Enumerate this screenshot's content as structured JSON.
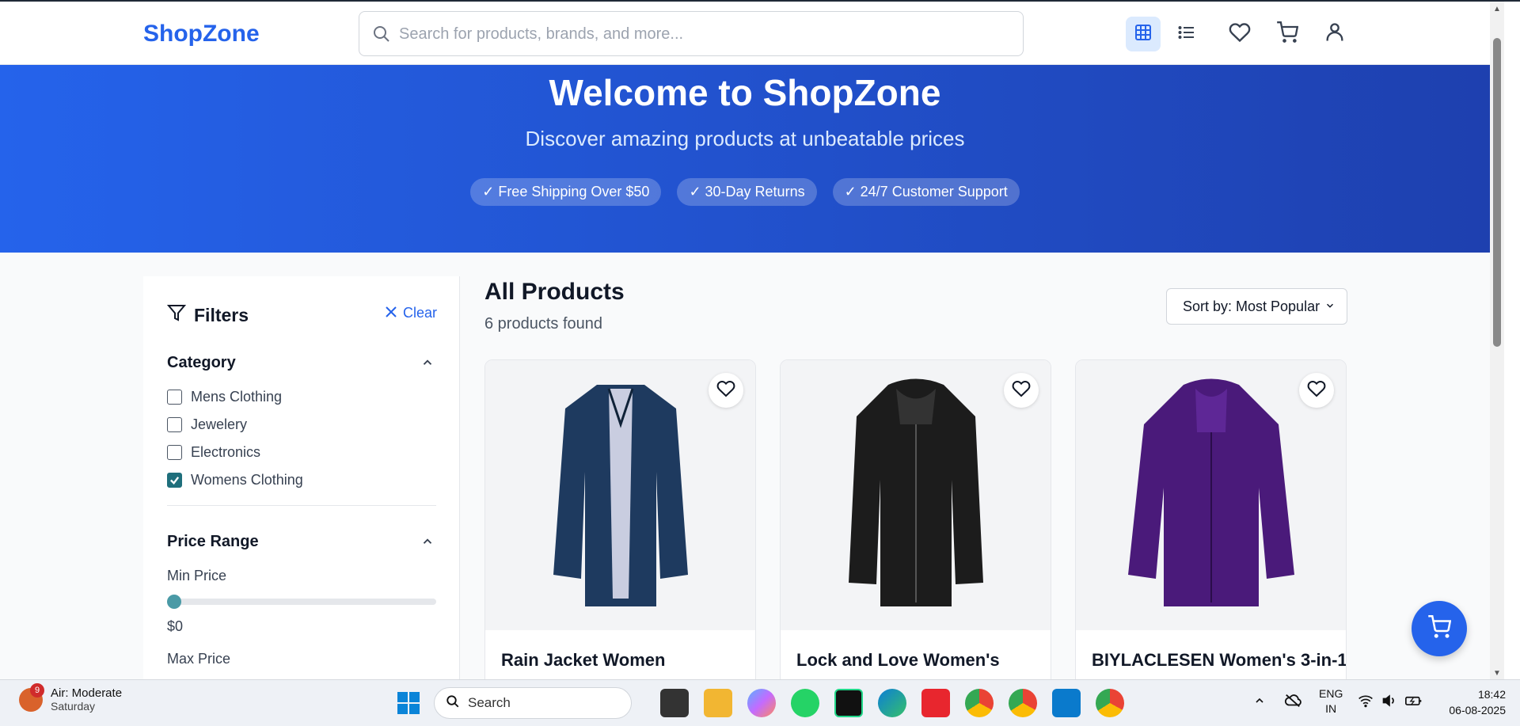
{
  "header": {
    "logo": "ShopZone",
    "search_placeholder": "Search for products, brands, and more...",
    "icons": [
      "grid-view-icon",
      "list-view-icon",
      "heart-icon",
      "cart-icon",
      "user-icon"
    ]
  },
  "hero": {
    "title": "Welcome to ShopZone",
    "subtitle": "Discover amazing products at unbeatable prices",
    "badges": [
      "✓ Free Shipping Over $50",
      "✓ 30-Day Returns",
      "✓ 24/7 Customer Support"
    ]
  },
  "filters": {
    "title": "Filters",
    "clear_label": "Clear",
    "category": {
      "title": "Category",
      "options": [
        {
          "label": "Mens Clothing",
          "checked": false
        },
        {
          "label": "Jewelery",
          "checked": false
        },
        {
          "label": "Electronics",
          "checked": false
        },
        {
          "label": "Womens Clothing",
          "checked": true
        }
      ]
    },
    "price": {
      "title": "Price Range",
      "min_label": "Min Price",
      "min_value": "$0",
      "min_fraction": 0,
      "max_label": "Max Price"
    }
  },
  "main": {
    "title": "All Products",
    "count": "6 products found",
    "sort_label": "Sort by: Most Popular"
  },
  "products": [
    {
      "name": "Rain Jacket Women",
      "color": "#1e3a5f"
    },
    {
      "name": "Lock and Love Women's",
      "color": "#1c1c1c"
    },
    {
      "name": "BIYLACLESEN Women's 3-in-1",
      "color": "#4a1a7a"
    }
  ],
  "taskbar": {
    "weather_badge": "9",
    "weather_title": "Air: Moderate",
    "weather_day": "Saturday",
    "search_label": "Search",
    "lang_line1": "ENG",
    "lang_line2": "IN",
    "time": "18:42",
    "date": "06-08-2025"
  },
  "colors": {
    "accent": "#2563eb",
    "checkbox": "#1f6f7c"
  }
}
